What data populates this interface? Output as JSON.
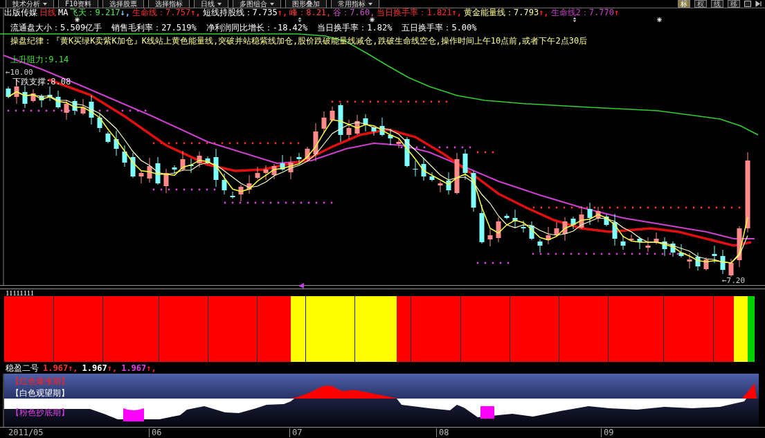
{
  "toolbar": {
    "buttons": [
      {
        "label": "技术分析",
        "kind": "menu"
      },
      {
        "label": "F10资料",
        "kind": "plain"
      },
      {
        "label": "选择股票",
        "kind": "plain"
      },
      {
        "label": "选择指标",
        "kind": "plain"
      },
      {
        "label": "日线",
        "kind": "menu"
      },
      {
        "label": "多图组合",
        "kind": "menu"
      },
      {
        "label": "图形叠加",
        "kind": "plain"
      },
      {
        "label": "常用指标",
        "kind": "menu"
      }
    ],
    "view_buttons": [
      {
        "label": "标",
        "selected": true
      },
      {
        "label": "权",
        "selected": false
      },
      {
        "label": "线",
        "selected": false
      },
      {
        "label": "移",
        "selected": false
      }
    ]
  },
  "main_chart": {
    "stock": "出版传媒",
    "period": "日线",
    "indicator": "MA",
    "readings": [
      {
        "text": "飞天：9.217",
        "arrow": {
          "text": "↓,",
          "color": "#80c0ff"
        },
        "color": "#50f050"
      },
      {
        "text": "生命线：7.757",
        "arrow": {
          "text": "↑,",
          "color": "#ff2020"
        },
        "color": "#ff3030"
      },
      {
        "text": "短线持股线：7.735",
        "arrow": {
          "text": "↑,",
          "color": "#ff2020"
        },
        "color": "#ffffff"
      },
      {
        "text": "峰：8.21,",
        "color": "#ff4040"
      },
      {
        "text": "谷：7.60,",
        "color": "#d050d0"
      },
      {
        "text": "当日换手率：1.821",
        "arrow": {
          "text": "↑,",
          "color": "#ff2020"
        },
        "color": "#ff3030"
      },
      {
        "text": "黄金能量线：7.793",
        "arrow": {
          "text": "↑,",
          "color": "#ff2020"
        },
        "color": "#ffff90"
      },
      {
        "text": "生命线2：7.770",
        "arrow": {
          "text": "↑",
          "color": "#ff2020"
        },
        "color": "#d040d0"
      }
    ],
    "info": [
      "流通盘大小：5.509亿手",
      "销售毛利率：27.519%",
      "净利润同比增长：-18.42%",
      "当日换手率：1.82%",
      "五日换手率：5.00%"
    ],
    "rule": "操盘纪律：『黄K买绿K卖紫K加仓』K线站上黄色能量线,突破并站稳紫线加仓,股价跌破能量线减仓,跌破生命线空仓,操作时间上午10点前,或者下午2点30后",
    "resistance": "上升阻力:9.14",
    "high_marker": "←10.00",
    "support": "下跌支撑:8.08",
    "low_marker": "←7.20"
  },
  "signal_panel": {
    "label": "11111111",
    "runs": [
      {
        "color": "#ff0000"
      },
      {
        "color": "#ffff00"
      },
      {
        "color": "#ff0000"
      },
      {
        "color": "#ffff00"
      },
      {
        "color": "#00d000"
      }
    ]
  },
  "indicator_panel": {
    "title": "稳盈二号",
    "readings": [
      {
        "text": "1.967",
        "arrow": {
          "text": "↑,",
          "color": "#ff2020"
        },
        "color": "#ff3030"
      },
      {
        "text": "1.967",
        "arrow": {
          "text": "↑,",
          "color": "#ff2020"
        },
        "color": "#ffffff"
      },
      {
        "text": "1.967",
        "arrow": {
          "text": "↑,",
          "color": "#ff2020"
        },
        "color": "#e040e0"
      }
    ],
    "legend": [
      {
        "text": "【红色爆涨期】",
        "color": "#ff2020"
      },
      {
        "text": "【白色观望期】",
        "color": "#ffffff"
      },
      {
        "text": "【粉色抄底期】",
        "color": "#e040e0"
      }
    ]
  },
  "time_axis": {
    "labels": [
      "2011/05",
      "06",
      "07",
      "08",
      "09"
    ]
  }
}
